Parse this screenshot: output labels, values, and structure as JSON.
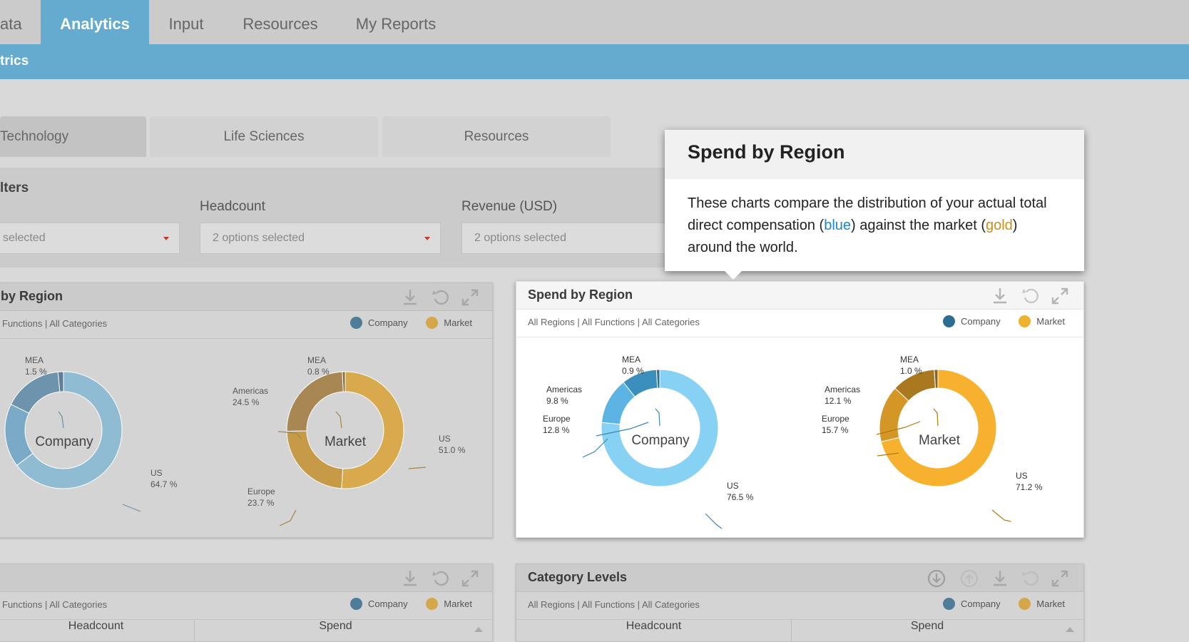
{
  "nav": {
    "tabs": [
      "ata",
      "Analytics",
      "Input",
      "Resources",
      "My Reports"
    ],
    "active_index": 1
  },
  "subheader": {
    "title": "trics"
  },
  "industry_tabs": [
    "Technology",
    "Life Sciences",
    "Resources"
  ],
  "filters": {
    "title": "lters",
    "first_value": "selected",
    "headcount": {
      "label": "Headcount",
      "value": "2 options selected"
    },
    "revenue": {
      "label": "Revenue (USD)",
      "value": "2 options selected"
    }
  },
  "colors": {
    "nav_accent": "#64abcf",
    "company": "#2c6d92",
    "market": "#e6a627",
    "tooltip_blue": "#1a86c2",
    "tooltip_gold": "#c8901e"
  },
  "legend": {
    "company": "Company",
    "market": "Market"
  },
  "icons": [
    "download-icon",
    "reset-icon",
    "expand-icon",
    "drill-down-icon",
    "drill-up-icon"
  ],
  "left_panel": {
    "title": "by Region",
    "subtitle": "Functions | All Categories",
    "company_chart": {
      "center": "Company",
      "labels": [
        {
          "name": "MEA",
          "value": "1.5 %"
        },
        {
          "name": "US",
          "value": "64.7 %"
        }
      ]
    },
    "market_chart": {
      "center": "Market",
      "labels": [
        {
          "name": "MEA",
          "value": "0.8 %"
        },
        {
          "name": "Americas",
          "value": "24.5 %"
        },
        {
          "name": "Europe",
          "value": "23.7 %"
        },
        {
          "name": "US",
          "value": "51.0 %"
        }
      ]
    }
  },
  "right_panel": {
    "title": "Spend by Region",
    "subtitle": "All Regions | All Functions | All Categories",
    "company_chart": {
      "center": "Company",
      "labels": [
        {
          "name": "MEA",
          "value": "0.9 %"
        },
        {
          "name": "Americas",
          "value": "9.8 %"
        },
        {
          "name": "Europe",
          "value": "12.8 %"
        },
        {
          "name": "US",
          "value": "76.5 %"
        }
      ]
    },
    "market_chart": {
      "center": "Market",
      "labels": [
        {
          "name": "MEA",
          "value": "1.0 %"
        },
        {
          "name": "Americas",
          "value": "12.1 %"
        },
        {
          "name": "Europe",
          "value": "15.7 %"
        },
        {
          "name": "US",
          "value": "71.2 %"
        }
      ]
    }
  },
  "bottom_left_panel": {
    "subtitle": "Functions | All Categories",
    "col_headcount": "Headcount",
    "col_spend": "Spend"
  },
  "bottom_right_panel": {
    "title": "Category Levels",
    "subtitle": "All Regions | All Functions | All Categories",
    "col_headcount": "Headcount",
    "col_spend": "Spend"
  },
  "tooltip": {
    "title": "Spend by Region",
    "text_1": "These charts compare the distribution of your actual total direct compensation (",
    "blue_word": "blue",
    "text_2": ") against the market (",
    "gold_word": "gold",
    "text_3": ") around the world."
  },
  "chart_data": [
    {
      "type": "pie",
      "title": "Company",
      "categories": [
        "US",
        "MEA"
      ],
      "values": [
        64.7,
        1.5
      ]
    },
    {
      "type": "pie",
      "title": "Market",
      "categories": [
        "US",
        "Europe",
        "Americas",
        "MEA"
      ],
      "values": [
        51.0,
        23.7,
        24.5,
        0.8
      ]
    },
    {
      "type": "pie",
      "title": "Company",
      "categories": [
        "US",
        "Europe",
        "Americas",
        "MEA"
      ],
      "values": [
        76.5,
        12.8,
        9.8,
        0.9
      ]
    },
    {
      "type": "pie",
      "title": "Market",
      "categories": [
        "US",
        "Europe",
        "Americas",
        "MEA"
      ],
      "values": [
        71.2,
        15.7,
        12.1,
        1.0
      ]
    }
  ]
}
